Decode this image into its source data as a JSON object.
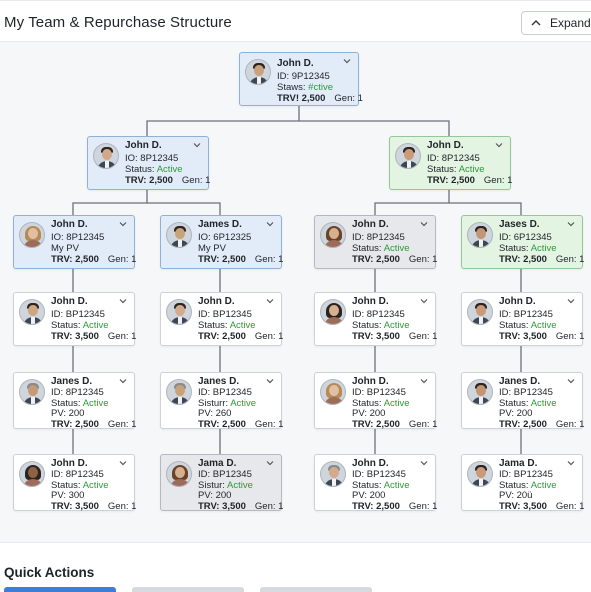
{
  "header": {
    "title": "My Team & Repurchase Structure",
    "expand_label": "Expand"
  },
  "nodes": [
    {
      "name": "John D.",
      "lines": [
        "ID: 9P12345",
        [
          "Staws: ",
          "#ctive"
        ],
        [
          "TRV! 2,500",
          "Gen: 1"
        ]
      ]
    },
    {
      "name": "John D.",
      "lines": [
        "IO: 8P12345",
        [
          "Status: ",
          "Active"
        ],
        [
          "TRV: 2,500",
          "Gen: 1"
        ]
      ]
    },
    {
      "name": "John D.",
      "lines": [
        "ID: 8P12345",
        [
          "Status: ",
          "Active"
        ],
        [
          "TRV: 2,500",
          "Gen: 1"
        ]
      ]
    },
    {
      "name": "John D.",
      "lines": [
        "IO: 8P12345",
        "My PV",
        [
          "TRV: 2,500",
          "Gen: 1"
        ]
      ]
    },
    {
      "name": "James D.",
      "lines": [
        "IO: 6P12325",
        "My PV",
        [
          "TRV: 2,500",
          "Gen: 1"
        ]
      ]
    },
    {
      "name": "John D.",
      "lines": [
        "ID: 8P12345",
        [
          "Status: ",
          "Active"
        ],
        [
          "TRV: 2,500",
          "Gen: 1"
        ]
      ]
    },
    {
      "name": "Jases D.",
      "lines": [
        "ID: 6P12345",
        [
          "Status: ",
          "Active"
        ],
        [
          "TRV: 2,500",
          "Gen: 1"
        ]
      ]
    },
    {
      "name": "John D.",
      "lines": [
        "ID: BP12345",
        [
          "Status: ",
          "Active"
        ],
        [
          "TRV: 3,500",
          "Gen: 1"
        ]
      ]
    },
    {
      "name": "John D.",
      "lines": [
        "ID: BP12345",
        [
          "Status: ",
          "Active"
        ],
        [
          "TRV: 2,500",
          "Gen: 1"
        ]
      ]
    },
    {
      "name": "John D.",
      "lines": [
        "ID: 8P12345",
        [
          "Status: ",
          "Active"
        ],
        [
          "TRV: 3,500",
          "Gen: 1"
        ]
      ]
    },
    {
      "name": "John D.",
      "lines": [
        "ID: BP12345",
        [
          "Status: ",
          "Active"
        ],
        [
          "TRV: 3,500",
          "Gen: 1"
        ]
      ]
    },
    {
      "name": "Janes D.",
      "lines": [
        "ID: 8P12345",
        [
          "Status: ",
          "Active"
        ],
        "PV: 200",
        [
          "TRV: 2,500",
          "Gen: 1"
        ]
      ]
    },
    {
      "name": "Janes D.",
      "lines": [
        "ID: BP12345",
        [
          "Sisturr: ",
          "Active"
        ],
        "PV: 260",
        [
          "TRV: 2,500",
          "Gen: 1"
        ]
      ]
    },
    {
      "name": "John D.",
      "lines": [
        "ID: BP12345",
        [
          "Status: ",
          "Active"
        ],
        "PV: 200",
        [
          "TRV: 2,500",
          "Gen: 1"
        ]
      ]
    },
    {
      "name": "Janes D.",
      "lines": [
        "ID: BP12345",
        [
          "Status: ",
          "Active"
        ],
        "PV: 200",
        [
          "TRV: 2,500",
          "Gen: 1"
        ]
      ]
    },
    {
      "name": "John D.",
      "lines": [
        "ID: 8P12345",
        [
          "Status: ",
          "Active"
        ],
        "PV: 300",
        [
          "TRV: 3,500",
          "Gen: 1"
        ]
      ]
    },
    {
      "name": "Jama D.",
      "lines": [
        "ID: BP12345",
        [
          "Sistur: ",
          "Active"
        ],
        "PV: 200",
        [
          "TRV: 3,500",
          "Gen: 1"
        ]
      ]
    },
    {
      "name": "John D.",
      "lines": [
        "ID: BP12345",
        [
          "Status: ",
          "Active"
        ],
        "PV: 200",
        [
          "TRV: 2,500",
          "Gen: 1"
        ]
      ]
    },
    {
      "name": "Jama D.",
      "lines": [
        "ID: BP12345",
        [
          "Status: ",
          "Active"
        ],
        "PV: 20ü",
        [
          "TRV: 3,500",
          "Gen: 1"
        ]
      ]
    }
  ],
  "footer": {
    "title": "Quick Actions"
  },
  "colors": {
    "active": "#2e9a3a",
    "blue_card": "#e2ecf8",
    "green_card": "#e4f4e3",
    "gray_card": "#e6e8eb",
    "accent": "#3b7dd8"
  },
  "icons": {
    "expand": "chevron-up-icon",
    "node_menu": "chevron-down-icon",
    "avatar": "person-photo"
  }
}
